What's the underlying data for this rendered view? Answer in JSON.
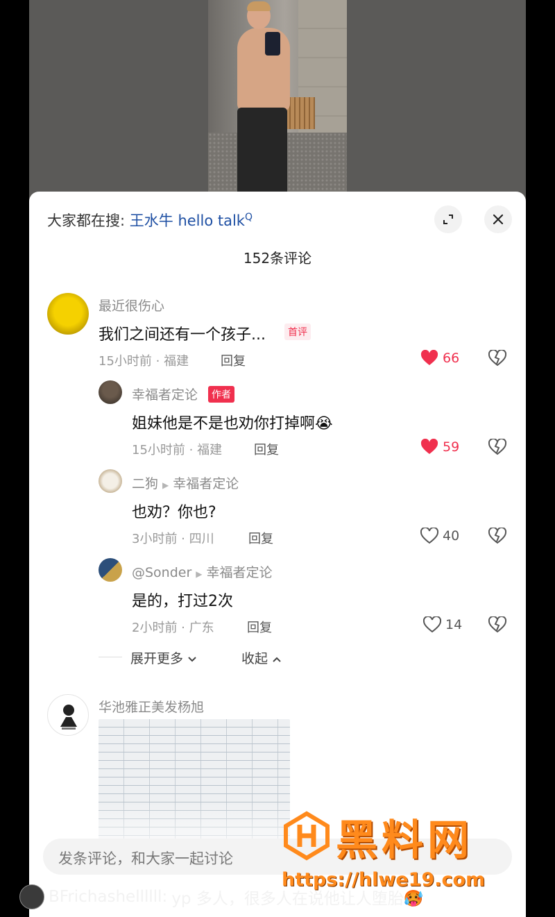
{
  "search": {
    "prefix": "大家都在搜:",
    "keyword": "王水牛 hello talk",
    "suffix": "Q"
  },
  "comment_count": "152条评论",
  "comments": [
    {
      "user": "最近很伤心",
      "text": "我们之间还有一个孩子...",
      "tag": "首评",
      "meta": "15小时前 · 福建",
      "reply": "回复",
      "likes": "66",
      "liked": true
    },
    {
      "user": "幸福者定论",
      "tag": "作者",
      "text": "姐妹他是不是也劝你打掉啊😭",
      "meta": "15小时前 · 福建",
      "reply": "回复",
      "likes": "59",
      "liked": true
    },
    {
      "user": "二狗",
      "reply_to": "幸福者定论",
      "text": "也劝？你也?",
      "meta": "3小时前 · 四川",
      "reply": "回复",
      "likes": "40",
      "liked": false
    },
    {
      "user": "@Sonder",
      "reply_to": "幸福者定论",
      "text": "是的，打过2次",
      "meta": "2小时前 · 广东",
      "reply": "回复",
      "likes": "14",
      "liked": false
    },
    {
      "user": "华池雅正美发杨旭"
    }
  ],
  "expand_more": "展开更多",
  "collapse": "收起",
  "input_placeholder": "发条评论，和大家一起讨论",
  "ticker": {
    "user": "BFrichashellllll:",
    "text": "yp 多人，很多人在说他让人堕胎🥵"
  },
  "watermark": {
    "title": "黑料网",
    "url": "https://hlwe19.com"
  },
  "colors": {
    "accent": "#f0304e",
    "link": "#1e4fa3",
    "watermark": "#ff8a1c"
  },
  "icons": [
    "search-icon",
    "expand-icon",
    "close-icon",
    "heart-icon",
    "broken-heart-icon",
    "chevron-down-icon",
    "chevron-up-icon",
    "reply-arrow-icon"
  ]
}
